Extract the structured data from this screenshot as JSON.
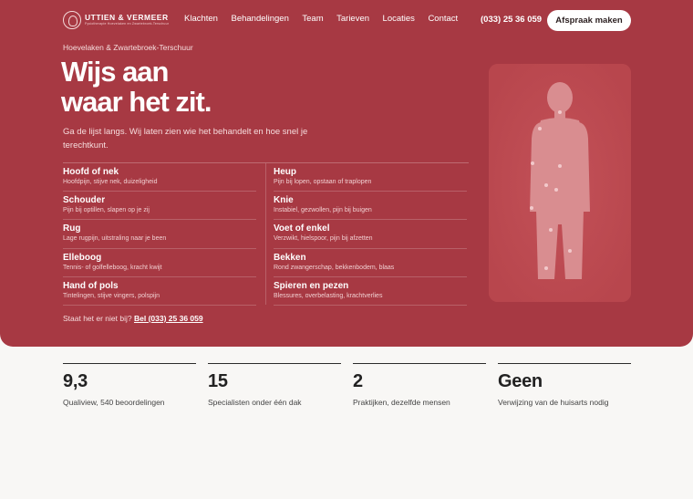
{
  "brand": {
    "name": "UTTIEN & VERMEER",
    "tagline": "Fysiotherapie Hoevelaken en Zwartebroek-Terschuur"
  },
  "nav": {
    "items": [
      "Klachten",
      "Behandelingen",
      "Team",
      "Tarieven",
      "Locaties",
      "Contact"
    ],
    "phone": "(033) 25 36 059",
    "cta_label": "Afspraak maken"
  },
  "hero": {
    "location": "Hoevelaken & Zwartebroek-Terschuur",
    "headline_line1": "Wijs aan",
    "headline_line2": "waar het zit.",
    "intro": "Ga de lijst langs. Wij laten zien wie het behandelt en hoe snel je terechtkunt.",
    "bottom_text": "Staat het er niet bij?",
    "bottom_link": "Bel (033) 25 36 059"
  },
  "complaints_left": [
    {
      "title": "Hoofd of nek",
      "desc": "Hoofdpijn, stijve nek, duizeligheid"
    },
    {
      "title": "Schouder",
      "desc": "Pijn bij optillen, slapen op je zij"
    },
    {
      "title": "Rug",
      "desc": "Lage rugpijn, uitstraling naar je been"
    },
    {
      "title": "Elleboog",
      "desc": "Tennis- of golfelleboog, kracht kwijt"
    },
    {
      "title": "Hand of pols",
      "desc": "Tintelingen, stijve vingers, polspijn"
    }
  ],
  "complaints_right": [
    {
      "title": "Heup",
      "desc": "Pijn bij lopen, opstaan of traplopen"
    },
    {
      "title": "Knie",
      "desc": "Instabiel, gezwollen, pijn bij buigen"
    },
    {
      "title": "Voet of enkel",
      "desc": "Verzwikt, hielspoor, pijn bij afzetten"
    },
    {
      "title": "Bekken",
      "desc": "Rond zwangerschap, bekkenbodem, blaas"
    },
    {
      "title": "Spieren en pezen",
      "desc": "Blessures, overbelasting, krachtverlies"
    }
  ],
  "stats": [
    {
      "value": "9,3",
      "label": "Qualiview, 540 beoordelingen"
    },
    {
      "value": "15",
      "label": "Specialisten onder één dak"
    },
    {
      "value": "2",
      "label": "Praktijken, dezelfde mensen"
    },
    {
      "value": "Geen",
      "label": "Verwijzing van de huisarts nodig"
    }
  ],
  "colors": {
    "hero_bg": "#a73943",
    "panel_bg": "#b8464d",
    "body_fill": "#d98d90",
    "page_bg": "#f8f7f5"
  }
}
